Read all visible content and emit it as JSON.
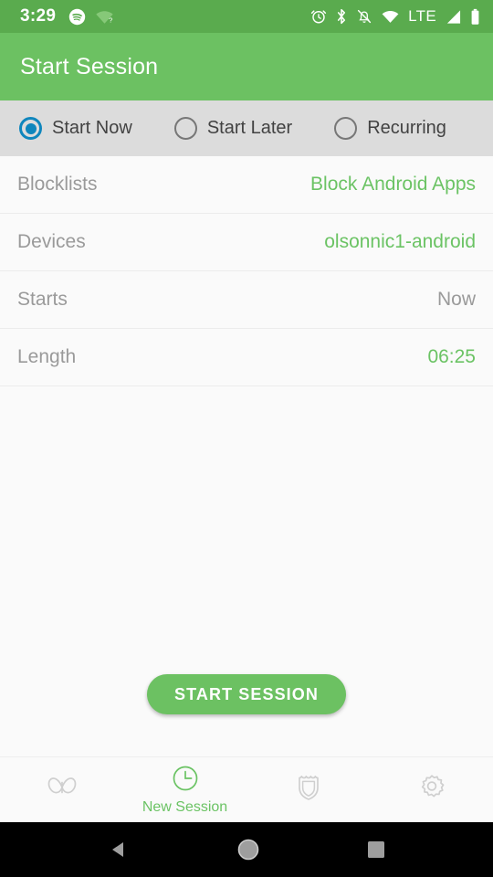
{
  "status_bar": {
    "time": "3:29",
    "left_icons": [
      "spotify-icon",
      "wifi-question-icon"
    ],
    "right_icons": [
      "alarm-icon",
      "bluetooth-icon",
      "notifications-off-icon",
      "wifi-off-icon",
      "lte-label",
      "signal-icon",
      "battery-icon"
    ],
    "network_label": "LTE",
    "background": "#5aab4e"
  },
  "app_bar": {
    "title": "Start Session",
    "background": "#6cc162"
  },
  "segments": {
    "items": [
      {
        "label": "Start Now",
        "selected": true
      },
      {
        "label": "Start Later",
        "selected": false
      },
      {
        "label": "Recurring",
        "selected": false
      }
    ],
    "selected_color": "#0f86bd",
    "background": "#dcdcdc"
  },
  "list": {
    "rows": [
      {
        "label": "Blocklists",
        "value": "Block Android Apps",
        "value_style": "accent"
      },
      {
        "label": "Devices",
        "value": "olsonnic1-android",
        "value_style": "accent"
      },
      {
        "label": "Starts",
        "value": "Now",
        "value_style": "muted"
      },
      {
        "label": "Length",
        "value": "06:25",
        "value_style": "accent"
      }
    ]
  },
  "primary_button": {
    "label": "START SESSION",
    "color": "#6cc162"
  },
  "tab_bar": {
    "accent": "#6bc364",
    "inactive": "#cfcfcf",
    "tabs": [
      {
        "icon": "butterfly-icon",
        "label": "",
        "active": false
      },
      {
        "icon": "clock-icon",
        "label": "New Session",
        "active": true
      },
      {
        "icon": "shield-icon",
        "label": "",
        "active": false
      },
      {
        "icon": "gear-icon",
        "label": "",
        "active": false
      }
    ]
  },
  "nav_bar": {
    "buttons": [
      "back-icon",
      "home-icon",
      "recents-icon"
    ]
  }
}
